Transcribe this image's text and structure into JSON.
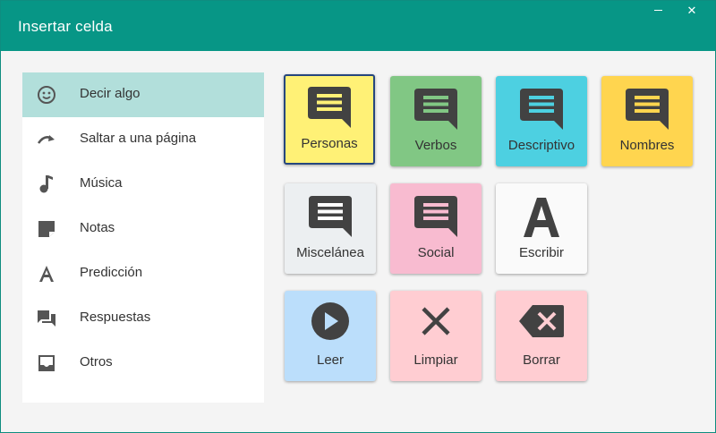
{
  "window": {
    "title": "Insertar celda",
    "minimize_symbol": "",
    "close_symbol": "✕"
  },
  "sidebar": {
    "items": [
      {
        "label": "Decir algo",
        "icon": "smiley-icon",
        "active": true
      },
      {
        "label": "Saltar a una página",
        "icon": "redo-arrow-icon",
        "active": false
      },
      {
        "label": "Música",
        "icon": "music-note-icon",
        "active": false
      },
      {
        "label": "Notas",
        "icon": "note-icon",
        "active": false
      },
      {
        "label": "Predicción",
        "icon": "letter-a-icon",
        "active": false
      },
      {
        "label": "Respuestas",
        "icon": "forum-icon",
        "active": false
      },
      {
        "label": "Otros",
        "icon": "inbox-icon",
        "active": false
      }
    ]
  },
  "tiles": [
    {
      "label": "Personas",
      "icon": "speech-bubble-icon",
      "bg": "#fff176",
      "accent": "#fff176",
      "selected": true
    },
    {
      "label": "Verbos",
      "icon": "speech-bubble-icon",
      "bg": "#81c784",
      "accent": "#81c784",
      "selected": false
    },
    {
      "label": "Descriptivo",
      "icon": "speech-bubble-icon",
      "bg": "#4dd0e1",
      "accent": "#4dd0e1",
      "selected": false
    },
    {
      "label": "Nombres",
      "icon": "speech-bubble-icon",
      "bg": "#ffd54f",
      "accent": "#ffd54f",
      "selected": false
    },
    {
      "label": "Miscelánea",
      "icon": "speech-bubble-icon",
      "bg": "#eceff1",
      "accent": "#ffffff",
      "selected": false
    },
    {
      "label": "Social",
      "icon": "speech-bubble-icon",
      "bg": "#f8bbd0",
      "accent": "#f8bbd0",
      "selected": false
    },
    {
      "label": "Escribir",
      "icon": "letter-a-icon",
      "bg": "#fafafa",
      "accent": "#fafafa",
      "selected": false
    },
    {
      "label": "Leer",
      "icon": "play-circle-icon",
      "bg": "#bbdefb",
      "accent": "#bbdefb",
      "selected": false
    },
    {
      "label": "Limpiar",
      "icon": "clear-x-icon",
      "bg": "#ffcdd2",
      "accent": "#ffcdd2",
      "selected": false
    },
    {
      "label": "Borrar",
      "icon": "backspace-icon",
      "bg": "#ffcdd2",
      "accent": "#ffcdd2",
      "selected": false
    }
  ],
  "colors": {
    "titlebar": "#079686",
    "icon_dark": "#424242",
    "sidebar_icon": "#555555",
    "selection_border": "#26477e"
  }
}
